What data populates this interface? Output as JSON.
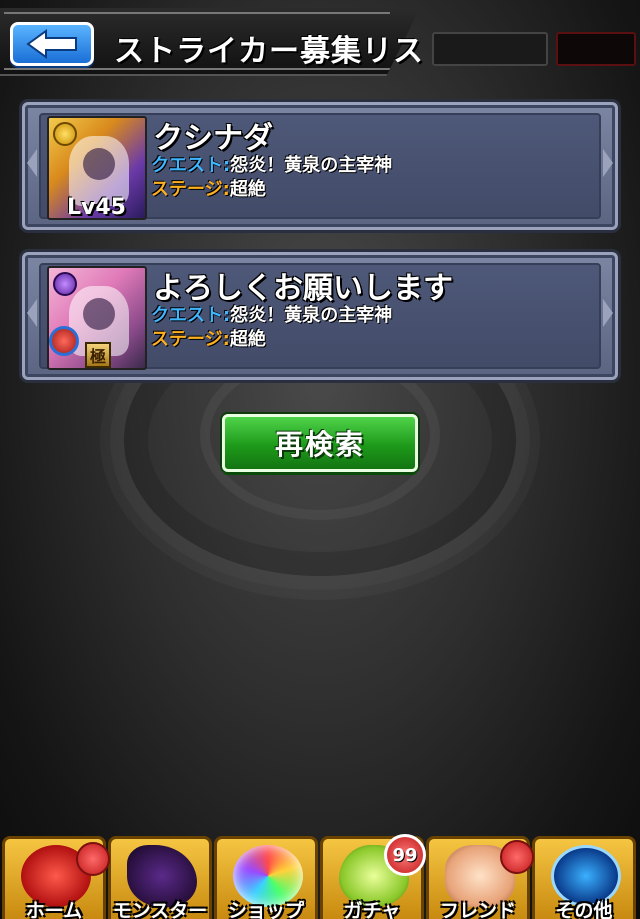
{
  "header": {
    "title": "ストライカー募集リスト",
    "back_icon": "back-arrow-icon"
  },
  "cards": [
    {
      "name": "クシナダ",
      "level": "Lv45",
      "quest_label": "クエスト:",
      "quest_value": "怨炎！黄泉の主宰神",
      "stage_label": "ステージ:",
      "stage_value": "超絶"
    },
    {
      "name": "よろしくお願いします",
      "badge": "極",
      "quest_label": "クエスト:",
      "quest_value": "怨炎！黄泉の主宰神",
      "stage_label": "ステージ:",
      "stage_value": "超絶"
    }
  ],
  "research_button": "再検索",
  "bottom_nav": {
    "items": [
      {
        "label": "ホーム",
        "icon": "home-icon"
      },
      {
        "label": "モンスター",
        "icon": "monster-icon"
      },
      {
        "label": "ショップ",
        "icon": "shop-orb-icon"
      },
      {
        "label": "ガチャ",
        "icon": "gacha-egg-icon"
      },
      {
        "label": "フレンド",
        "icon": "friend-handshake-icon"
      },
      {
        "label": "その他",
        "icon": "other-radar-icon"
      }
    ],
    "gacha_badge": "99"
  },
  "colors": {
    "quest_label": "#3fb6ff",
    "stage_label": "#ffb020",
    "research_button": "#1e9a1a",
    "back_button": "#1a6fd6"
  }
}
